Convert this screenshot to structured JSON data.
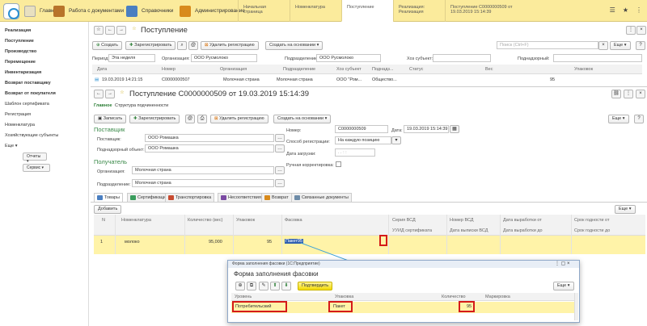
{
  "topbar": {
    "sections": [
      {
        "label": "Главное"
      },
      {
        "label": "Работа с документами"
      },
      {
        "label": "Справочники"
      },
      {
        "label": "Администрирование"
      }
    ],
    "tabs": [
      {
        "label": "Начальная страница"
      },
      {
        "label": "Номенклатура"
      },
      {
        "label": "Поступление"
      },
      {
        "label": "Реализация: Реализация"
      },
      {
        "label": "Поступление С0000000509 от 19.03.2019 15:14:39"
      }
    ]
  },
  "sidebar": {
    "items": [
      {
        "label": "Реализация",
        "bold": true
      },
      {
        "label": "Поступление",
        "bold": true
      },
      {
        "label": "Производство",
        "bold": true
      },
      {
        "label": "Перемещение",
        "bold": true
      },
      {
        "label": "Инвентаризация",
        "bold": true
      },
      {
        "label": "Возврат поставщику",
        "bold": true
      },
      {
        "label": "Возврат от покупателя",
        "bold": true
      },
      {
        "label": "Шаблон сертификата",
        "bold": false
      },
      {
        "label": "Регистрация",
        "bold": false
      },
      {
        "label": "Номенклатура",
        "bold": false
      },
      {
        "label": "Хозяйствующие субъекты",
        "bold": false
      },
      {
        "label": "Еще",
        "bold": false
      }
    ],
    "reports": "Отчеты",
    "service": "Сервис"
  },
  "list": {
    "title": "Поступление",
    "create": "Создать",
    "register": "Зарегистрировать",
    "delete_reg": "Удалить регистрацию",
    "create_based": "Создать на основании",
    "search_placeholder": "Поиск (Ctrl+F)",
    "more": "Еще",
    "filters": {
      "period_label": "Период:",
      "period_value": "Эта неделя",
      "org_label": "Организация:",
      "org_value": "ООО Русмолоко",
      "subdiv_label": "Подразделение:",
      "subdiv_value": "ООО Русмолоко",
      "hoz_label": "Хоз субъект:",
      "subobj_label": "Поднадзорный:"
    },
    "columns": [
      "Дата",
      "Номер",
      "Организация",
      "Подразделение",
      "Хоз субъект",
      "Поднадз...",
      "Статус",
      "Вес",
      "Упаковок"
    ],
    "row": [
      "19.03.2019 14:21:15",
      "С0000000507",
      "Молочная страна",
      "Молочная страна",
      "ООО \"Ром...",
      "Общество...",
      "",
      "",
      "95"
    ]
  },
  "doc": {
    "title": "Поступление С0000000509 от 19.03.2019 15:14:39",
    "subtabs": [
      "Главное",
      "Структура подчиненности"
    ],
    "save": "Записать",
    "register": "Зарегистрировать",
    "at": "@",
    "delete_reg": "Удалить регистрацию",
    "create_based": "Создать на основании",
    "more": "Еще",
    "help": "?",
    "supplier_head": "Поставщик",
    "supplier_label": "Поставщик:",
    "supplier_value": "ООО Ромашка",
    "sub_object_label": "Поднадзорный объект:",
    "sub_object_value": "ООО Ромашка",
    "receiver_head": "Получатель",
    "org_label": "Организация:",
    "org_value": "Молочная страна",
    "subdiv_label": "Подразделение:",
    "subdiv_value": "Молочная страна",
    "number_label": "Номер:",
    "number_value": "С0000000509",
    "date_label": "Дата:",
    "date_value": "19.03.2019 15:14:39",
    "reg_mode_label": "Способ регистрации:",
    "reg_mode_value": "На каждую позицию",
    "load_date_label": "Дата загрузки:",
    "load_date_value": ". .   : :",
    "manual_label": "Ручная корректировка:"
  },
  "tabs": [
    "Товары",
    "Сертификация",
    "Транспортировка",
    "Несоответствия",
    "Возврат",
    "Связанные документы"
  ],
  "goods": {
    "add": "Добавить",
    "more": "Еще",
    "columns_top": [
      "N",
      "Номенклатура",
      "Количество (вес)",
      "Упаковок",
      "Фасовка",
      "Серия ВСД",
      "Номер ВСД",
      "Дата выработки от",
      "Срок годности от"
    ],
    "columns_bottom": [
      "",
      "",
      "",
      "",
      "",
      "УУИД сертификата",
      "Дата выписки ВСД",
      "Дата выработки до",
      "Срок годности до"
    ],
    "row": {
      "n": "1",
      "name": "молоко",
      "qty": "95,000",
      "packs": "95",
      "packing": "Пакет95"
    }
  },
  "popup": {
    "window_title": "Форма заполнения фасовки (1С:Предприятие)",
    "title": "Форма заполнения фасовки",
    "confirm": "Подтвердить",
    "more": "Еще",
    "columns": [
      "Уровень",
      "Упаковка",
      "Количество",
      "Маркировка"
    ],
    "row": [
      "Потребительский",
      "Пакет",
      "95",
      ""
    ]
  },
  "colors": {
    "accent_yellow": "#fbeb9c",
    "selected_row": "#fff3a8",
    "highlight_red": "#d41a1a",
    "green_text": "#2a7d34"
  }
}
